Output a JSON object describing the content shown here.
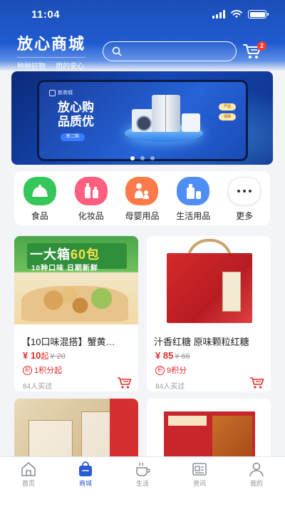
{
  "status_bar": {
    "time": "11:04"
  },
  "header": {
    "title": "放心商城",
    "slogan": [
      "种种好物",
      "用的安心"
    ],
    "search": {
      "placeholder": "",
      "icon": "search-icon"
    },
    "cart": {
      "icon": "cart-icon",
      "badge_count": "2"
    }
  },
  "banner": {
    "logo_text": "新商城",
    "headline": "放心购 品质优",
    "button_text": "新二购",
    "tags": [
      "严选",
      "保障"
    ],
    "slides_total": 3,
    "active_slide": 1
  },
  "categories": [
    {
      "label": "食品",
      "icon": "food-icon"
    },
    {
      "label": "化妆品",
      "icon": "cosmetics-icon"
    },
    {
      "label": "母婴用品",
      "icon": "baby-products-icon"
    },
    {
      "label": "生活用品",
      "icon": "daily-goods-icon"
    },
    {
      "label": "更多",
      "icon": "more-icon"
    }
  ],
  "products": [
    {
      "image_text_big": "一大箱",
      "image_text_num": "60包",
      "image_text_sub": "10种口味 日期新鲜",
      "name": "【10口味混搭】蟹黄…",
      "price": "¥ 10",
      "price_suffix": "起",
      "old_price": "¥ 20",
      "points_badge": "积",
      "points": "1积分起",
      "buyers": "84人买过"
    },
    {
      "name": "汁香红糖 原味颗粒红糖",
      "price": "¥ 85",
      "old_price": "¥ 66",
      "points_badge": "积",
      "points": "9积分",
      "buyers": "84人买过"
    },
    {
      "name": "",
      "price": "",
      "old_price": ""
    },
    {
      "name": "",
      "price": "",
      "old_price": ""
    }
  ],
  "tabbar": {
    "active": "商城",
    "items": [
      {
        "label": "首页",
        "icon": "home-icon"
      },
      {
        "label": "商城",
        "icon": "shop-bag-icon"
      },
      {
        "label": "生活",
        "icon": "coffee-cup-icon"
      },
      {
        "label": "资讯",
        "icon": "news-icon"
      },
      {
        "label": "我的",
        "icon": "user-icon"
      }
    ]
  },
  "colors": {
    "brand_blue": "#1f5bd0",
    "accent_red": "#e22b2b",
    "tab_active": "#2a5bd7"
  }
}
